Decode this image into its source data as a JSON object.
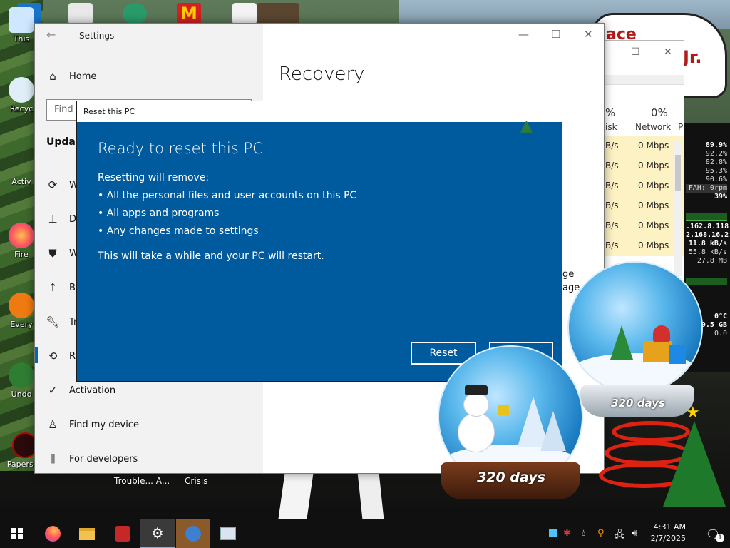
{
  "desktop": {
    "icons": [
      {
        "label": "This"
      },
      {
        "label": "Recyc"
      },
      {
        "label": "Activ"
      },
      {
        "label": "Fire"
      },
      {
        "label": "Every"
      },
      {
        "label": "Undo"
      },
      {
        "label": "Papers, P"
      }
    ],
    "bottom_labels": [
      "Trouble... A...",
      "Crisis"
    ],
    "sign_text": [
      "ace",
      "Jr."
    ]
  },
  "monitor": {
    "values": [
      "89.9%",
      "92.2%",
      "82.8%",
      "95.3%",
      "90.6%",
      "FAH: 0rpm",
      "39%",
      ".162.8.118",
      "2.168.16.2",
      "11.8 kB/s",
      "55.8 kB/s",
      "27.8 MB",
      "0°C",
      "9.5 GB",
      "0.0"
    ]
  },
  "taskmanager": {
    "col_partial": "%",
    "col_partial_label": "isk",
    "network_pct": "0%",
    "network_label": "Network",
    "extra_col": "P",
    "disk_rows": [
      "B/s",
      "B/s",
      "B/s",
      "B/s",
      "B/s",
      "B/s"
    ],
    "network_rows": [
      "0 Mbps",
      "0 Mbps",
      "0 Mbps",
      "0 Mbps",
      "0 Mbps",
      "0 Mbps"
    ]
  },
  "settings": {
    "window_title": "Settings",
    "search_placeholder": "Find",
    "section": "Update",
    "page_title": "Recovery",
    "nav": [
      {
        "label": "Home",
        "icon": "home-icon"
      },
      {
        "label": "W",
        "icon": "sync-icon"
      },
      {
        "label": "De",
        "icon": "delivery-icon"
      },
      {
        "label": "W",
        "icon": "shield-icon"
      },
      {
        "label": "Ba",
        "icon": "backup-icon"
      },
      {
        "label": "Tr",
        "icon": "wrench-icon"
      },
      {
        "label": "Re",
        "icon": "recovery-icon"
      },
      {
        "label": "Activation",
        "icon": "check-circle-icon"
      },
      {
        "label": "Find my device",
        "icon": "person-pin-icon"
      },
      {
        "label": "For developers",
        "icon": "developer-icon"
      }
    ],
    "partial_right": [
      "ge",
      "age."
    ]
  },
  "dialog": {
    "title": "Reset this PC",
    "heading": "Ready to reset this PC",
    "intro": "Resetting will remove:",
    "bullets": [
      "• All the personal files and user accounts on this PC",
      "• All apps and programs",
      "• Any changes made to settings"
    ],
    "note": "This will take a while and your PC will restart.",
    "reset_label": "Reset",
    "cancel_label": ""
  },
  "decorations": {
    "globe_label": "320 days",
    "globe_label_small": "320 days"
  },
  "taskbar": {
    "time": "4:31 AM",
    "date": "2/7/2025",
    "notification_count": "1"
  },
  "colors": {
    "dialog_blue": "#005a9e",
    "accent": "#0067c0"
  }
}
